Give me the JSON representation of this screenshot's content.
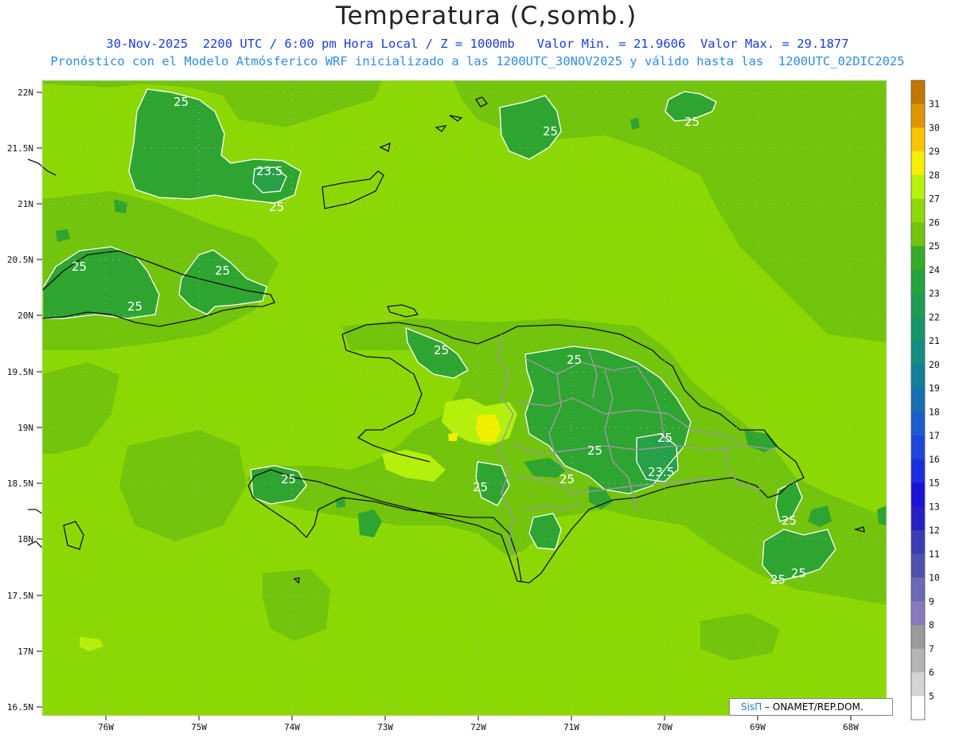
{
  "header": {
    "title": "Temperatura (C,somb.)",
    "subtitle_line1": "30-Nov-2025  2200 UTC / 6:00 pm Hora Local / Z = 1000mb   Valor Min. = 21.9606  Valor Max. = 29.1877",
    "subtitle_line2": "Pronóstico con el Modelo Atmósferico WRF inicializado a las 1200UTC_30NOV2025 y válido hasta las  1200UTC_02DIC2025"
  },
  "map": {
    "lat_ticks": [
      "22N",
      "21.5N",
      "21N",
      "20.5N",
      "20N",
      "19.5N",
      "19N",
      "18.5N",
      "18N",
      "17.5N",
      "17N",
      "16.5N"
    ],
    "lon_ticks": [
      "76W",
      "75W",
      "74W",
      "73W",
      "72W",
      "71W",
      "70W",
      "69W",
      "68W"
    ],
    "contour_labels": [
      "25",
      "23.5",
      "25",
      "25",
      "25",
      "25",
      "25",
      "25",
      "25",
      "25",
      "25",
      "23.5",
      "25",
      "25",
      "25",
      "25",
      "25"
    ],
    "colors": {
      "background_field": "#8cd804",
      "field_26": "#72c40c",
      "field_25": "#3fb022",
      "field_24": "#2fa531",
      "field_23": "#27a047",
      "warm_27": "#b4f00c",
      "warm_28": "#f0f000",
      "coastline": "#111111",
      "borders": "#9a9a9a",
      "contour": "#ffffff"
    }
  },
  "legend": {
    "levels": [
      "31",
      "30",
      "29",
      "28",
      "27",
      "26",
      "25",
      "24",
      "23",
      "22",
      "21",
      "20",
      "19",
      "18",
      "17",
      "16",
      "15",
      "13",
      "12",
      "11",
      "10",
      "9",
      "8",
      "7",
      "6",
      "5"
    ],
    "colors": [
      "#c07800",
      "#e09600",
      "#ffc400",
      "#f5f000",
      "#b6f20a",
      "#8ed806",
      "#72c40c",
      "#34ac28",
      "#27a33e",
      "#1e9c52",
      "#16956a",
      "#138c82",
      "#117f98",
      "#1670b4",
      "#1c5ccc",
      "#1e46da",
      "#1a2ee0",
      "#1a14d8",
      "#2820c4",
      "#3c3cb4",
      "#5050b0",
      "#6a6ab6",
      "#8878bc",
      "#9a9a9a",
      "#b4b4b4",
      "#d4d4d4"
    ]
  },
  "credit": {
    "brand": "SisΠ",
    "org": "– ONAMET/REP.DOM."
  }
}
